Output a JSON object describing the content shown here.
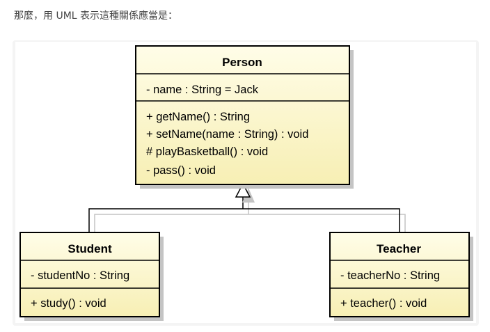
{
  "intro_text": "那麼，用 UML 表示這種關係應當是：",
  "diagram": {
    "classes": [
      {
        "id": "person",
        "name": "Person",
        "attributes": [
          "- name : String = Jack"
        ],
        "operations": [
          "+ getName() : String",
          "+ setName(name : String) : void",
          "# playBasketball() : void",
          "- pass() : void"
        ]
      },
      {
        "id": "student",
        "name": "Student",
        "attributes": [
          "- studentNo : String"
        ],
        "operations": [
          "+ study() : void"
        ]
      },
      {
        "id": "teacher",
        "name": "Teacher",
        "attributes": [
          "- teacherNo : String"
        ],
        "operations": [
          "+ teacher() : void"
        ]
      }
    ],
    "relations": [
      {
        "type": "generalization",
        "from": "student",
        "to": "person"
      },
      {
        "type": "generalization",
        "from": "teacher",
        "to": "person"
      }
    ],
    "colors": {
      "class_fill_top": "#fffde8",
      "class_fill_bottom": "#f7efb4",
      "border": "#000000",
      "shadow": "#c4c4c4"
    }
  }
}
